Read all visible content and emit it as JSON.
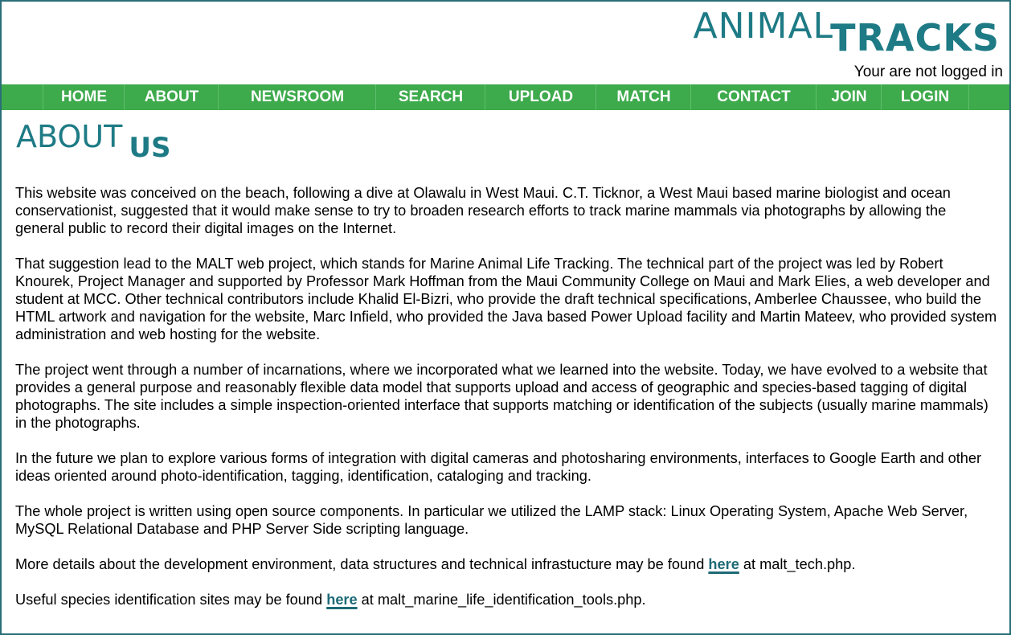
{
  "logo": {
    "part1": "ANIMAL",
    "part2": "TRACKS"
  },
  "login_status": "Your are not logged in",
  "nav": {
    "items": [
      "HOME",
      "ABOUT",
      "NEWSROOM",
      "SEARCH",
      "UPLOAD",
      "MATCH",
      "CONTACT",
      "JOIN",
      "LOGIN"
    ]
  },
  "heading": {
    "part1": "ABOUT",
    "part2": "US"
  },
  "paragraphs": [
    "This website was conceived on the beach, following a dive at Olawalu in West Maui. C.T. Ticknor, a West Maui based marine biologist and ocean conservationist, suggested that it would make sense to try to broaden research efforts to track marine mammals via photographs by allowing the general public to record their digital images on the Internet.",
    "That suggestion lead to the MALT web project, which stands for Marine Animal Life Tracking. The technical part of the project was led by Robert Knourek, Project Manager and supported by Professor Mark Hoffman from the Maui Community College on Maui and Mark Elies, a web developer and student at MCC. Other technical contributors include Khalid El-Bizri, who provide the draft technical specifications, Amberlee Chaussee, who build the HTML artwork and navigation for the website, Marc Infield, who provided the Java based Power Upload facility and Martin Mateev, who provided system administration and web hosting for the website.",
    "The project went through a number of incarnations, where we incorporated what we learned into the website. Today, we have evolved to a website that provides a general purpose and reasonably flexible data model that supports upload and access of geographic and species-based tagging of digital photographs. The site includes a simple inspection-oriented interface that supports matching or identification of the subjects (usually marine mammals) in the photographs.",
    "In the future we plan to explore various forms of integration with digital cameras and photosharing environments, interfaces to Google Earth and other ideas oriented around photo-identification, tagging, identification, cataloging and tracking.",
    "The whole project is written using open source components. In particular we utilized the LAMP stack: Linux Operating System, Apache Web Server, MySQL Relational Database and PHP Server Side scripting language."
  ],
  "tech_details": {
    "before": "More details about the development environment, data structures and technical infrastucture may be found ",
    "link": "here",
    "after": " at malt_tech.php."
  },
  "species_tools": {
    "before": "Useful species identification sites may be found ",
    "link": "here",
    "after": " at malt_marine_life_identification_tools.php."
  }
}
